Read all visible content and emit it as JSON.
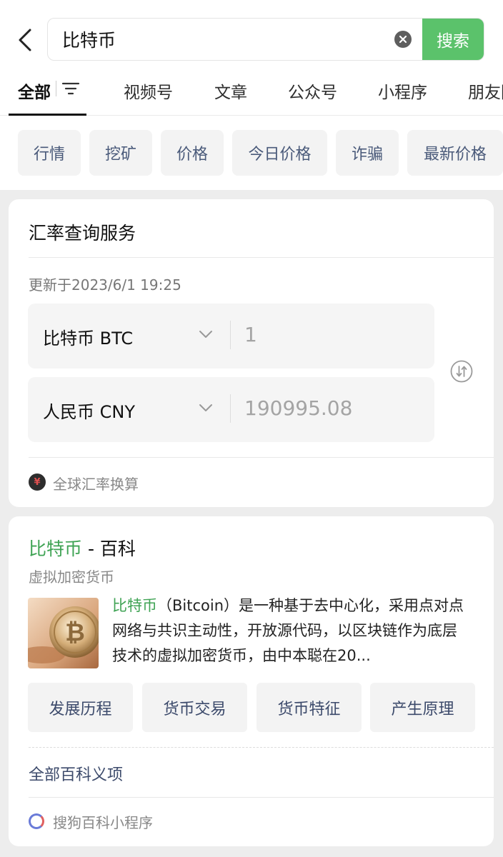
{
  "search": {
    "query": "比特币",
    "button_label": "搜索"
  },
  "tabs": [
    {
      "label": "全部"
    },
    {
      "label": "视频号"
    },
    {
      "label": "文章"
    },
    {
      "label": "公众号"
    },
    {
      "label": "小程序"
    },
    {
      "label": "朋友圈"
    }
  ],
  "chips": [
    "行情",
    "挖矿",
    "价格",
    "今日价格",
    "诈骗",
    "最新价格"
  ],
  "exchange": {
    "title": "汇率查询服务",
    "updated": "更新于2023/6/1 19:25",
    "from": {
      "currency": "比特币 BTC",
      "value": "1"
    },
    "to": {
      "currency": "人民币 CNY",
      "value": "190995.08"
    },
    "footer_link": "全球汇率换算"
  },
  "baike": {
    "title_highlight": "比特币",
    "title_suffix": " - 百科",
    "subtitle": "虚拟加密货币",
    "desc_highlight": "比特币",
    "desc_text": "（Bitcoin）是一种基于去中心化，采用点对点网络与共识主动性，开放源代码，以区块链作为底层技术的虚拟加密货币，由中本聪在20...",
    "buttons": [
      "发展历程",
      "货币交易",
      "货币特征",
      "产生原理"
    ],
    "all_link": "全部百科义项",
    "mini_program": "搜狗百科小程序"
  },
  "colors": {
    "accent_green": "#5bc26b",
    "highlight_green": "#3fa354",
    "link_blue": "#3c4a6b",
    "page_bg": "#ededed"
  }
}
